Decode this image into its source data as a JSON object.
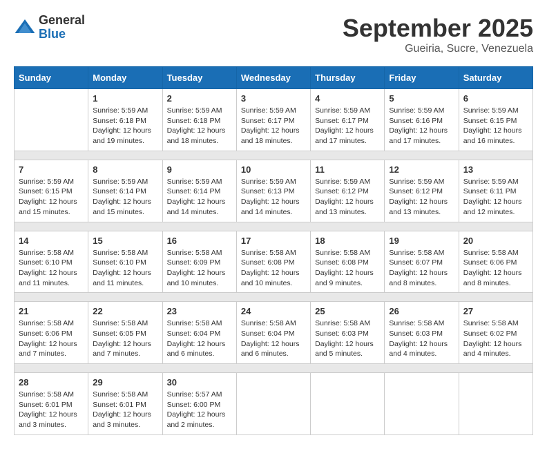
{
  "logo": {
    "general": "General",
    "blue": "Blue"
  },
  "title": "September 2025",
  "subtitle": "Gueiria, Sucre, Venezuela",
  "headers": [
    "Sunday",
    "Monday",
    "Tuesday",
    "Wednesday",
    "Thursday",
    "Friday",
    "Saturday"
  ],
  "weeks": [
    [
      {
        "day": "",
        "sunrise": "",
        "sunset": "",
        "daylight": ""
      },
      {
        "day": "1",
        "sunrise": "Sunrise: 5:59 AM",
        "sunset": "Sunset: 6:18 PM",
        "daylight": "Daylight: 12 hours and 19 minutes."
      },
      {
        "day": "2",
        "sunrise": "Sunrise: 5:59 AM",
        "sunset": "Sunset: 6:18 PM",
        "daylight": "Daylight: 12 hours and 18 minutes."
      },
      {
        "day": "3",
        "sunrise": "Sunrise: 5:59 AM",
        "sunset": "Sunset: 6:17 PM",
        "daylight": "Daylight: 12 hours and 18 minutes."
      },
      {
        "day": "4",
        "sunrise": "Sunrise: 5:59 AM",
        "sunset": "Sunset: 6:17 PM",
        "daylight": "Daylight: 12 hours and 17 minutes."
      },
      {
        "day": "5",
        "sunrise": "Sunrise: 5:59 AM",
        "sunset": "Sunset: 6:16 PM",
        "daylight": "Daylight: 12 hours and 17 minutes."
      },
      {
        "day": "6",
        "sunrise": "Sunrise: 5:59 AM",
        "sunset": "Sunset: 6:15 PM",
        "daylight": "Daylight: 12 hours and 16 minutes."
      }
    ],
    [
      {
        "day": "7",
        "sunrise": "Sunrise: 5:59 AM",
        "sunset": "Sunset: 6:15 PM",
        "daylight": "Daylight: 12 hours and 15 minutes."
      },
      {
        "day": "8",
        "sunrise": "Sunrise: 5:59 AM",
        "sunset": "Sunset: 6:14 PM",
        "daylight": "Daylight: 12 hours and 15 minutes."
      },
      {
        "day": "9",
        "sunrise": "Sunrise: 5:59 AM",
        "sunset": "Sunset: 6:14 PM",
        "daylight": "Daylight: 12 hours and 14 minutes."
      },
      {
        "day": "10",
        "sunrise": "Sunrise: 5:59 AM",
        "sunset": "Sunset: 6:13 PM",
        "daylight": "Daylight: 12 hours and 14 minutes."
      },
      {
        "day": "11",
        "sunrise": "Sunrise: 5:59 AM",
        "sunset": "Sunset: 6:12 PM",
        "daylight": "Daylight: 12 hours and 13 minutes."
      },
      {
        "day": "12",
        "sunrise": "Sunrise: 5:59 AM",
        "sunset": "Sunset: 6:12 PM",
        "daylight": "Daylight: 12 hours and 13 minutes."
      },
      {
        "day": "13",
        "sunrise": "Sunrise: 5:59 AM",
        "sunset": "Sunset: 6:11 PM",
        "daylight": "Daylight: 12 hours and 12 minutes."
      }
    ],
    [
      {
        "day": "14",
        "sunrise": "Sunrise: 5:58 AM",
        "sunset": "Sunset: 6:10 PM",
        "daylight": "Daylight: 12 hours and 11 minutes."
      },
      {
        "day": "15",
        "sunrise": "Sunrise: 5:58 AM",
        "sunset": "Sunset: 6:10 PM",
        "daylight": "Daylight: 12 hours and 11 minutes."
      },
      {
        "day": "16",
        "sunrise": "Sunrise: 5:58 AM",
        "sunset": "Sunset: 6:09 PM",
        "daylight": "Daylight: 12 hours and 10 minutes."
      },
      {
        "day": "17",
        "sunrise": "Sunrise: 5:58 AM",
        "sunset": "Sunset: 6:08 PM",
        "daylight": "Daylight: 12 hours and 10 minutes."
      },
      {
        "day": "18",
        "sunrise": "Sunrise: 5:58 AM",
        "sunset": "Sunset: 6:08 PM",
        "daylight": "Daylight: 12 hours and 9 minutes."
      },
      {
        "day": "19",
        "sunrise": "Sunrise: 5:58 AM",
        "sunset": "Sunset: 6:07 PM",
        "daylight": "Daylight: 12 hours and 8 minutes."
      },
      {
        "day": "20",
        "sunrise": "Sunrise: 5:58 AM",
        "sunset": "Sunset: 6:06 PM",
        "daylight": "Daylight: 12 hours and 8 minutes."
      }
    ],
    [
      {
        "day": "21",
        "sunrise": "Sunrise: 5:58 AM",
        "sunset": "Sunset: 6:06 PM",
        "daylight": "Daylight: 12 hours and 7 minutes."
      },
      {
        "day": "22",
        "sunrise": "Sunrise: 5:58 AM",
        "sunset": "Sunset: 6:05 PM",
        "daylight": "Daylight: 12 hours and 7 minutes."
      },
      {
        "day": "23",
        "sunrise": "Sunrise: 5:58 AM",
        "sunset": "Sunset: 6:04 PM",
        "daylight": "Daylight: 12 hours and 6 minutes."
      },
      {
        "day": "24",
        "sunrise": "Sunrise: 5:58 AM",
        "sunset": "Sunset: 6:04 PM",
        "daylight": "Daylight: 12 hours and 6 minutes."
      },
      {
        "day": "25",
        "sunrise": "Sunrise: 5:58 AM",
        "sunset": "Sunset: 6:03 PM",
        "daylight": "Daylight: 12 hours and 5 minutes."
      },
      {
        "day": "26",
        "sunrise": "Sunrise: 5:58 AM",
        "sunset": "Sunset: 6:03 PM",
        "daylight": "Daylight: 12 hours and 4 minutes."
      },
      {
        "day": "27",
        "sunrise": "Sunrise: 5:58 AM",
        "sunset": "Sunset: 6:02 PM",
        "daylight": "Daylight: 12 hours and 4 minutes."
      }
    ],
    [
      {
        "day": "28",
        "sunrise": "Sunrise: 5:58 AM",
        "sunset": "Sunset: 6:01 PM",
        "daylight": "Daylight: 12 hours and 3 minutes."
      },
      {
        "day": "29",
        "sunrise": "Sunrise: 5:58 AM",
        "sunset": "Sunset: 6:01 PM",
        "daylight": "Daylight: 12 hours and 3 minutes."
      },
      {
        "day": "30",
        "sunrise": "Sunrise: 5:57 AM",
        "sunset": "Sunset: 6:00 PM",
        "daylight": "Daylight: 12 hours and 2 minutes."
      },
      {
        "day": "",
        "sunrise": "",
        "sunset": "",
        "daylight": ""
      },
      {
        "day": "",
        "sunrise": "",
        "sunset": "",
        "daylight": ""
      },
      {
        "day": "",
        "sunrise": "",
        "sunset": "",
        "daylight": ""
      },
      {
        "day": "",
        "sunrise": "",
        "sunset": "",
        "daylight": ""
      }
    ]
  ]
}
